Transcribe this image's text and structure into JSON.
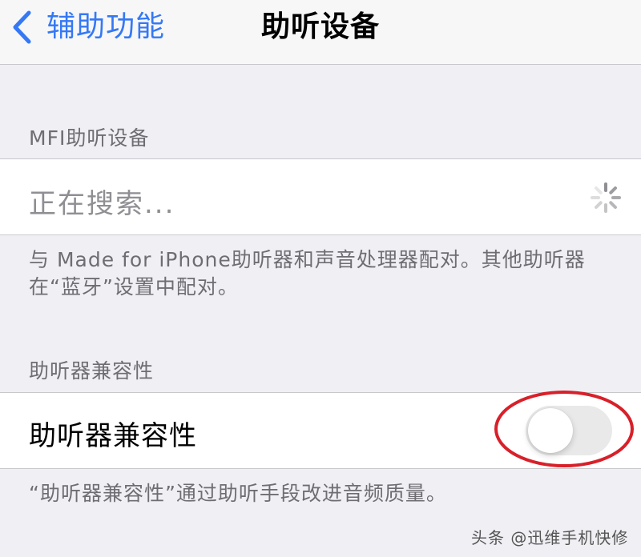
{
  "nav": {
    "back_label": "辅助功能",
    "title": "助听设备"
  },
  "mfi_section": {
    "header": "MFI助听设备",
    "searching_label": "正在搜索...",
    "footer": "与 Made for iPhone助听器和声音处理器配对。其他助听器在“蓝牙”设置中配对。"
  },
  "hac_section": {
    "header": "助听器兼容性",
    "toggle_label": "助听器兼容性",
    "toggle_on": false,
    "footer": "“助听器兼容性”通过助听手段改进音频质量。"
  },
  "colors": {
    "accent": "#3478f6",
    "annotation": "#d8202a"
  },
  "watermark": "头条 @迅维手机快修"
}
